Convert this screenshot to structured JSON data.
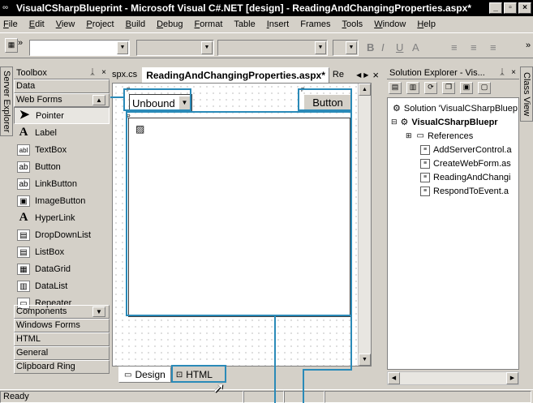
{
  "window": {
    "title": "VisualCSharpBlueprint - Microsoft Visual C#.NET [design] - ReadingAndChangingProperties.aspx*"
  },
  "menu": {
    "items": [
      {
        "u": "F",
        "rest": "ile"
      },
      {
        "u": "E",
        "rest": "dit"
      },
      {
        "u": "V",
        "rest": "iew"
      },
      {
        "u": "P",
        "rest": "roject"
      },
      {
        "u": "B",
        "rest": "uild"
      },
      {
        "u": "D",
        "rest": "ebug"
      },
      {
        "u": "F",
        "rest": "ormat",
        "pre": ""
      },
      {
        "u": "",
        "rest": "Table"
      },
      {
        "u": "I",
        "rest": "nsert"
      },
      {
        "u": "",
        "rest": "Frames"
      },
      {
        "u": "T",
        "rest": "ools"
      },
      {
        "u": "W",
        "rest": "indow"
      },
      {
        "u": "H",
        "rest": "elp"
      }
    ]
  },
  "toolbar": {
    "format_buttons": [
      "B",
      "I",
      "U",
      "A",
      "≡",
      "≡",
      "≡"
    ],
    "overflow": "»"
  },
  "side_tabs": {
    "left": "Server Explorer",
    "right": "Class View"
  },
  "toolbox": {
    "title": "Toolbox",
    "pin": "ᚔ",
    "close": "×",
    "categories_top": [
      "Data",
      "Web Forms"
    ],
    "items": [
      {
        "label": "Pointer",
        "icon": "pointer-icon",
        "glyph": "➤"
      },
      {
        "label": "Label",
        "icon": "label-icon",
        "glyph": "A"
      },
      {
        "label": "TextBox",
        "icon": "textbox-icon",
        "glyph": "abl"
      },
      {
        "label": "Button",
        "icon": "button-icon",
        "glyph": "ab"
      },
      {
        "label": "LinkButton",
        "icon": "linkbutton-icon",
        "glyph": "ab"
      },
      {
        "label": "ImageButton",
        "icon": "imagebutton-icon",
        "glyph": "▣"
      },
      {
        "label": "HyperLink",
        "icon": "hyperlink-icon",
        "glyph": "A"
      },
      {
        "label": "DropDownList",
        "icon": "dropdownlist-icon",
        "glyph": "▤"
      },
      {
        "label": "ListBox",
        "icon": "listbox-icon",
        "glyph": "▤"
      },
      {
        "label": "DataGrid",
        "icon": "datagrid-icon",
        "glyph": "▦"
      },
      {
        "label": "DataList",
        "icon": "datalist-icon",
        "glyph": "▥"
      },
      {
        "label": "Repeater",
        "icon": "repeater-icon",
        "glyph": "▭"
      }
    ],
    "categories_bottom": [
      "Components",
      "Windows Forms",
      "HTML",
      "General",
      "Clipboard Ring"
    ]
  },
  "documents": {
    "tabs": [
      "spx.cs",
      "ReadingAndChangingProperties.aspx*",
      "Re"
    ],
    "nav_prev": "◀",
    "nav_next": "▶",
    "close": "×"
  },
  "designer": {
    "dropdown_value": "Unbound",
    "button_label": "Button",
    "image_glyph": "▨"
  },
  "view_tabs": {
    "design": "Design",
    "html": "HTML"
  },
  "solution_explorer": {
    "title": "Solution Explorer - Vis...",
    "pin": "ᚔ",
    "close": "×",
    "solution": "Solution 'VisualCSharpBluep",
    "project": "VisualCSharpBluepr",
    "references": "References",
    "files": [
      "AddServerControl.a",
      "CreateWebForm.as",
      "ReadingAndChangi",
      "RespondToEvent.a"
    ]
  },
  "status": {
    "text": "Ready"
  },
  "colors": {
    "chrome": "#d4d0c8",
    "titlebar": "#000000",
    "callout": "#2a8ab8"
  }
}
